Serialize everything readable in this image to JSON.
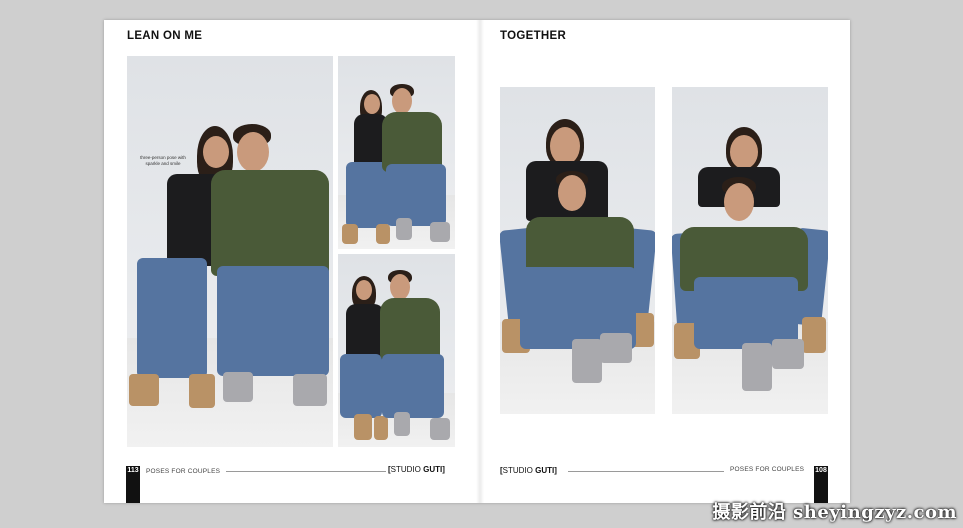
{
  "left_page": {
    "title": "LEAN ON ME",
    "caption": "three-person pose with sparkle and smile",
    "footer": {
      "page_number": "113",
      "label": "POSES FOR COUPLES",
      "logo_prefix": "STUDIO",
      "logo_brand": "GUTI"
    }
  },
  "right_page": {
    "title": "TOGETHER",
    "footer": {
      "page_number": "108",
      "label": "POSES FOR COUPLES",
      "logo_prefix": "STUDIO",
      "logo_brand": "GUTI"
    }
  },
  "watermark": "摄影前沿 sheyingzyz.com",
  "colors": {
    "page": "#ffffff",
    "background": "#cfcfcf",
    "shirt_green": "#4a5a38",
    "shirt_black": "#1c1c1e",
    "jeans": "#5574a0"
  }
}
